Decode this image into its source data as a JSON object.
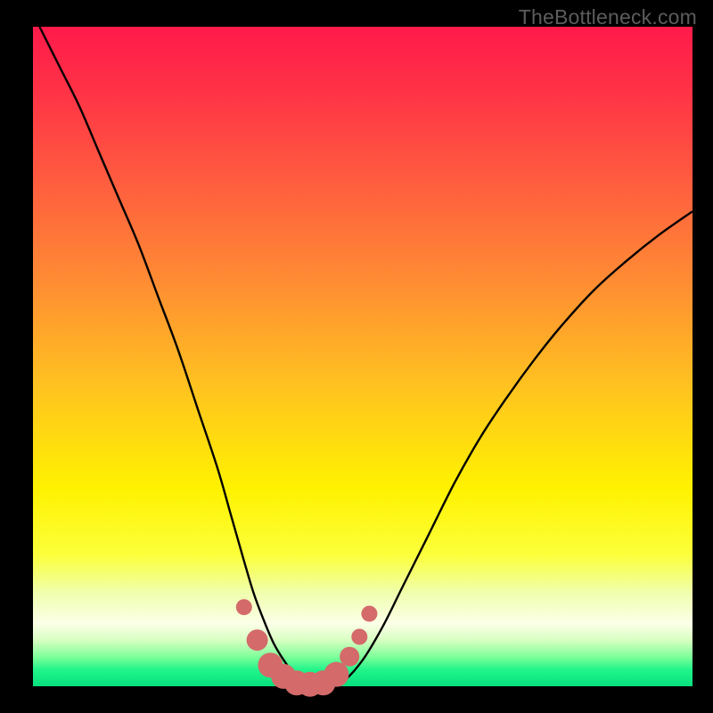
{
  "watermark": "TheBottleneck.com",
  "chart_data": {
    "type": "line",
    "title": "",
    "xlabel": "",
    "ylabel": "",
    "xlim": [
      0,
      100
    ],
    "ylim": [
      0,
      100
    ],
    "grid": false,
    "legend": false,
    "series": [
      {
        "name": "bottleneck-curve",
        "x": [
          1,
          4,
          7,
          10,
          13,
          16,
          19,
          22,
          25,
          28,
          30,
          32,
          33.5,
          35,
          36.5,
          38,
          39.5,
          41,
          43,
          45,
          47,
          50,
          53,
          56,
          60,
          64,
          68,
          72,
          76,
          80,
          85,
          90,
          95,
          100
        ],
        "y": [
          100,
          94,
          88,
          81,
          74,
          67,
          59,
          51,
          42,
          33,
          26,
          19,
          14,
          10,
          6.5,
          4,
          2,
          1,
          0.2,
          0.1,
          0.7,
          4,
          9,
          15,
          23,
          31,
          38,
          44,
          49.5,
          54.5,
          60,
          64.5,
          68.5,
          72
        ],
        "color": "#000000"
      },
      {
        "name": "marker-cluster",
        "type": "scatter",
        "x": [
          32,
          34,
          36,
          38,
          40,
          42,
          44,
          46,
          48,
          49.5,
          51
        ],
        "y": [
          12,
          7,
          3.2,
          1.5,
          0.5,
          0.3,
          0.5,
          1.8,
          4.5,
          7.5,
          11
        ],
        "color": "#d46a6a",
        "marker": "circle",
        "sizes": [
          9,
          12,
          14,
          14,
          14,
          14,
          14,
          14,
          11,
          9,
          9
        ]
      }
    ],
    "background_gradient": {
      "stops": [
        {
          "offset": 0.0,
          "color": "#ff1a4a"
        },
        {
          "offset": 0.1,
          "color": "#ff3346"
        },
        {
          "offset": 0.22,
          "color": "#ff5840"
        },
        {
          "offset": 0.38,
          "color": "#ff8a34"
        },
        {
          "offset": 0.55,
          "color": "#ffc41f"
        },
        {
          "offset": 0.7,
          "color": "#fff200"
        },
        {
          "offset": 0.8,
          "color": "#fcff3a"
        },
        {
          "offset": 0.86,
          "color": "#efffb0"
        },
        {
          "offset": 0.905,
          "color": "#fcffe8"
        },
        {
          "offset": 0.93,
          "color": "#d8ffc2"
        },
        {
          "offset": 0.955,
          "color": "#80ff9a"
        },
        {
          "offset": 0.975,
          "color": "#21f58a"
        },
        {
          "offset": 1.0,
          "color": "#07e07e"
        }
      ]
    }
  }
}
